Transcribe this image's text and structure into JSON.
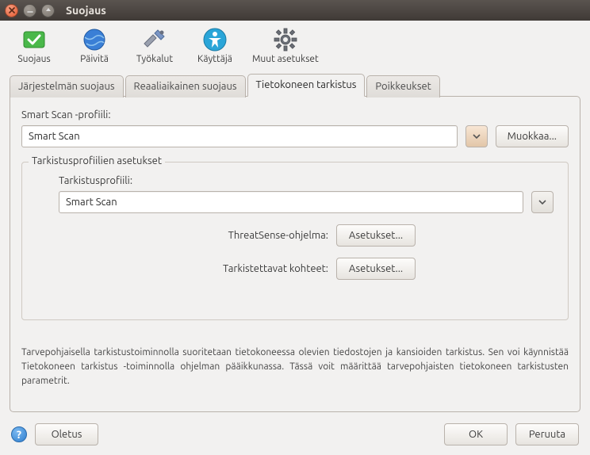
{
  "window": {
    "title": "Suojaus"
  },
  "toolbar": {
    "items": [
      {
        "label": "Suojaus"
      },
      {
        "label": "Päivitä"
      },
      {
        "label": "Työkalut"
      },
      {
        "label": "Käyttäjä"
      },
      {
        "label": "Muut asetukset"
      }
    ]
  },
  "tabs": [
    {
      "label": "Järjestelmän suojaus"
    },
    {
      "label": "Reaaliaikainen suojaus"
    },
    {
      "label": "Tietokoneen tarkistus"
    },
    {
      "label": "Poikkeukset"
    }
  ],
  "active_tab_index": 2,
  "panel": {
    "profile_label": "Smart Scan -profiili:",
    "profile_value": "Smart Scan",
    "edit_button": "Muokkaa...",
    "fieldset_legend": "Tarkistusprofiilien asetukset",
    "inner_profile_label": "Tarkistusprofiili:",
    "inner_profile_value": "Smart Scan",
    "threatsense_label": "ThreatSense-ohjelma:",
    "targets_label": "Tarkistettavat kohteet:",
    "settings_button": "Asetukset...",
    "description": "Tarvepohjaisella tarkistustoiminnolla suoritetaan tietokoneessa olevien tiedostojen ja kansioiden tarkistus. Sen voi käynnistää Tietokoneen tarkistus -toiminnolla ohjelman pääikkunassa. Tässä voit määrittää tarvepohjaisten tietokoneen tarkistusten parametrit."
  },
  "footer": {
    "default": "Oletus",
    "ok": "OK",
    "cancel": "Peruuta"
  }
}
